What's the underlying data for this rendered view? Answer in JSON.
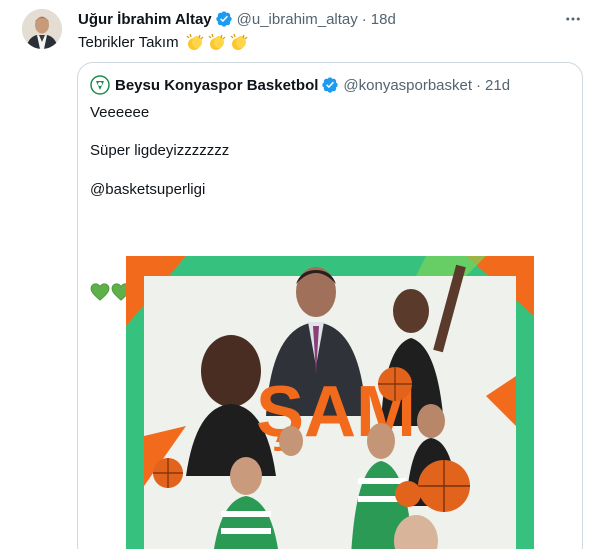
{
  "tweet": {
    "author_name": "Uğur İbrahim Altay",
    "handle": "@u_ibrahim_altay",
    "separator": "·",
    "time": "18d",
    "text": "Tebrikler Takım",
    "clap_emoji_count": 3,
    "verified_color": "#1d9bf0"
  },
  "quote": {
    "author_name": "Beysu Konyaspor Basketbol",
    "handle": "@konyasporbasket",
    "separator": "·",
    "time": "21d",
    "lines": [
      "Veeeeee",
      "Süper ligdeyizzzzzzz",
      "@basketsuperligi"
    ],
    "hearts": [
      "green",
      "green",
      "white",
      "green",
      "white",
      "green",
      "white",
      "green"
    ],
    "heart_green": "#5fb04a",
    "poster_text": "ŞAM"
  },
  "colors": {
    "text_primary": "#0f1419",
    "text_secondary": "#536471",
    "border": "#cfd9de",
    "poster_green": "#37c17e",
    "poster_orange": "#f26b1d"
  }
}
